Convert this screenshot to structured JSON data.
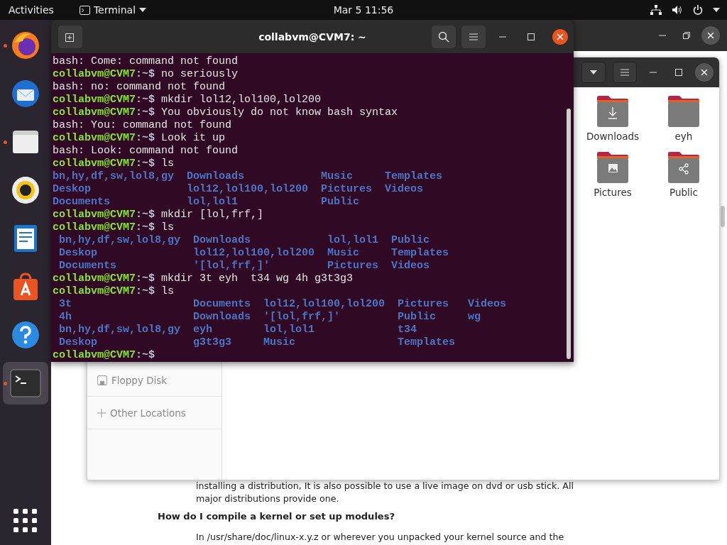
{
  "top_bar": {
    "activities": "Activities",
    "app_menu": "Terminal",
    "clock": "Mar 5  11:56"
  },
  "dock": {
    "items": [
      {
        "kind": "browser",
        "running": true,
        "selected": false
      },
      {
        "kind": "mail",
        "running": false,
        "selected": false
      },
      {
        "kind": "files",
        "running": true,
        "selected": false
      },
      {
        "kind": "music",
        "running": false,
        "selected": false
      },
      {
        "kind": "document",
        "running": false,
        "selected": false
      },
      {
        "kind": "store",
        "running": false,
        "selected": false
      },
      {
        "kind": "help",
        "running": false,
        "selected": false
      },
      {
        "kind": "terminal",
        "running": true,
        "selected": true
      }
    ]
  },
  "browser": {
    "content": [
      {
        "kind": "paragraph",
        "lines": [
          "installing a distribution, It is also possible to use a live image on dvd or usb stick. All",
          "major distributions provide one."
        ]
      },
      {
        "kind": "heading",
        "lines": [
          "How do I compile a kernel or set up modules?"
        ]
      },
      {
        "kind": "paragraph",
        "lines": [
          "In /usr/share/doc/linux-x.y.z or wherever you unpacked your kernel source and the"
        ]
      }
    ]
  },
  "file_manager": {
    "sidebar": [
      {
        "kind": "floppy",
        "label": "Floppy Disk"
      },
      {
        "kind": "other",
        "label": "Other Locations"
      }
    ],
    "folders": [
      {
        "kind": "download",
        "label": "Downloads"
      },
      {
        "kind": "plain",
        "label": "eyh"
      },
      {
        "kind": "image",
        "label": "Pictures"
      },
      {
        "kind": "share",
        "label": "Public"
      }
    ]
  },
  "terminal": {
    "title": "collabvm@CVM7: ~",
    "lines": [
      {
        "kind": "output",
        "text": "bash: Come: command not found"
      },
      {
        "kind": "prompt",
        "user": "collabvm@CVM7",
        "path": ":~$",
        "command": "no seriously"
      },
      {
        "kind": "output",
        "text": "bash: no: command not found"
      },
      {
        "kind": "prompt",
        "user": "collabvm@CVM7",
        "path": ":~$",
        "command": "mkdir lol12,lol100,lol200"
      },
      {
        "kind": "prompt",
        "user": "collabvm@CVM7",
        "path": ":~$",
        "command": "You obviously do not know bash syntax"
      },
      {
        "kind": "output",
        "text": "bash: You: command not found"
      },
      {
        "kind": "prompt",
        "user": "collabvm@CVM7",
        "path": ":~$",
        "command": "Look it up"
      },
      {
        "kind": "output",
        "text": "bash: Look: command not found"
      },
      {
        "kind": "prompt",
        "user": "collabvm@CVM7",
        "path": ":~$",
        "command": "ls"
      },
      {
        "kind": "listing",
        "indent": false,
        "rows": [
          [
            "bn,hy,df,sw,lol8,gy",
            "Downloads",
            "Music",
            "Templates"
          ],
          [
            "Deskop",
            "lol12,lol100,lol200",
            "Pictures",
            "Videos"
          ],
          [
            "Documents",
            "lol,lol1",
            "Public"
          ]
        ]
      },
      {
        "kind": "prompt",
        "user": "collabvm@CVM7",
        "path": ":~$",
        "command": "mkdir [lol,frf,]"
      },
      {
        "kind": "prompt",
        "user": "collabvm@CVM7",
        "path": ":~$",
        "command": "ls"
      },
      {
        "kind": "listing",
        "indent": true,
        "rows": [
          [
            "bn,hy,df,sw,lol8,gy",
            "Downloads",
            "lol,lol1",
            "Public"
          ],
          [
            "Deskop",
            "lol12,lol100,lol200",
            "Music",
            "Templates"
          ],
          [
            "Documents",
            "'[lol,frf,]'",
            "Pictures",
            "Videos"
          ]
        ]
      },
      {
        "kind": "prompt",
        "user": "collabvm@CVM7",
        "path": ":~$",
        "command": "mkdir 3t eyh  t34 wg 4h g3t3g3"
      },
      {
        "kind": "prompt",
        "user": "collabvm@CVM7",
        "path": ":~$",
        "command": "ls"
      },
      {
        "kind": "listing",
        "indent": true,
        "rows": [
          [
            "3t",
            "Documents",
            "lol12,lol100,lol200",
            "Pictures",
            "Videos"
          ],
          [
            "4h",
            "Downloads",
            "'[lol,frf,]'",
            "Public",
            "wg"
          ],
          [
            "bn,hy,df,sw,lol8,gy",
            "eyh",
            "lol,lol1",
            "t34"
          ],
          [
            "Deskop",
            "g3t3g3",
            "Music",
            "Templates"
          ]
        ]
      },
      {
        "kind": "prompt",
        "user": "collabvm@CVM7",
        "path": ":~$"
      }
    ]
  }
}
